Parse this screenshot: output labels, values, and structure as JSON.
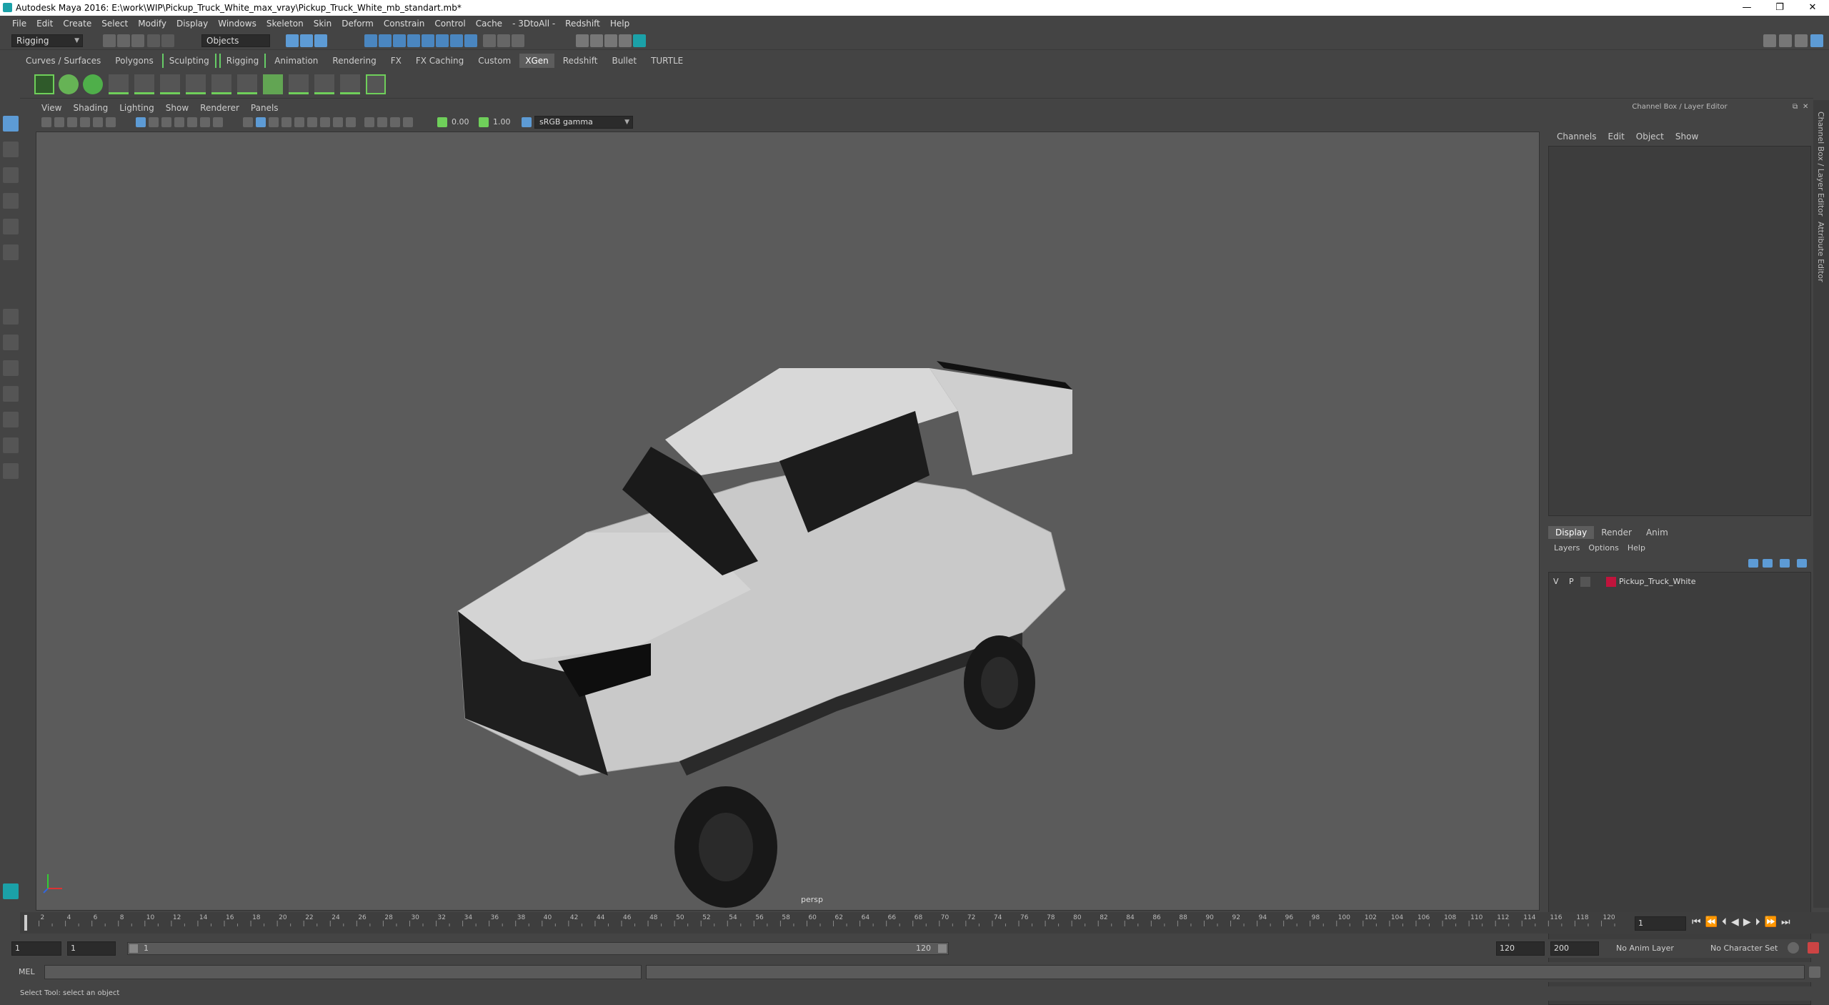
{
  "window": {
    "title": "Autodesk Maya 2016: E:\\work\\WIP\\Pickup_Truck_White_max_vray\\Pickup_Truck_White_mb_standart.mb*",
    "minimize": "—",
    "maximize": "❐",
    "close": "✕"
  },
  "menubar": [
    "File",
    "Edit",
    "Create",
    "Select",
    "Modify",
    "Display",
    "Windows",
    "Skeleton",
    "Skin",
    "Deform",
    "Constrain",
    "Control",
    "Cache",
    "- 3DtoAll -",
    "Redshift",
    "Help"
  ],
  "statusline": {
    "mode": "Rigging",
    "selection_mode": "Objects"
  },
  "shelf_tabs": [
    {
      "label": "Curves / Surfaces",
      "active": false,
      "bracket": false
    },
    {
      "label": "Polygons",
      "active": false,
      "bracket": false
    },
    {
      "label": "Sculpting",
      "active": false,
      "bracket": true
    },
    {
      "label": "Rigging",
      "active": false,
      "bracket": true
    },
    {
      "label": "Animation",
      "active": false,
      "bracket": false
    },
    {
      "label": "Rendering",
      "active": false,
      "bracket": false
    },
    {
      "label": "FX",
      "active": false,
      "bracket": false
    },
    {
      "label": "FX Caching",
      "active": false,
      "bracket": false
    },
    {
      "label": "Custom",
      "active": false,
      "bracket": false
    },
    {
      "label": "XGen",
      "active": true,
      "bracket": false
    },
    {
      "label": "Redshift",
      "active": false,
      "bracket": false
    },
    {
      "label": "Bullet",
      "active": false,
      "bracket": false
    },
    {
      "label": "TURTLE",
      "active": false,
      "bracket": false
    }
  ],
  "viewport": {
    "menu": [
      "View",
      "Shading",
      "Lighting",
      "Show",
      "Renderer",
      "Panels"
    ],
    "exposure": "0.00",
    "gamma": "1.00",
    "color_space": "sRGB gamma",
    "camera_label": "persp"
  },
  "channel_box": {
    "title": "Channel Box / Layer Editor",
    "menu": [
      "Channels",
      "Edit",
      "Object",
      "Show"
    ]
  },
  "layer_editor": {
    "tabs": [
      "Display",
      "Render",
      "Anim"
    ],
    "active_tab": "Display",
    "menu": [
      "Layers",
      "Options",
      "Help"
    ],
    "layers": [
      {
        "v": "V",
        "p": "P",
        "color": "#c0143c",
        "name": "Pickup_Truck_White"
      }
    ]
  },
  "right_strip": {
    "tab1": "Channel Box / Layer Editor",
    "tab2": "Attribute Editor"
  },
  "timeline": {
    "ticks": [
      "2",
      "4",
      "6",
      "8",
      "10",
      "12",
      "14",
      "16",
      "18",
      "20",
      "22",
      "24",
      "26",
      "28",
      "30",
      "32",
      "34",
      "36",
      "38",
      "40",
      "42",
      "44",
      "46",
      "48",
      "50",
      "52",
      "54",
      "56",
      "58",
      "60",
      "62",
      "64",
      "66",
      "68",
      "70",
      "72",
      "74",
      "76",
      "78",
      "80",
      "82",
      "84",
      "86",
      "88",
      "90",
      "92",
      "94",
      "96",
      "98",
      "100",
      "102",
      "104",
      "106",
      "108",
      "110",
      "112",
      "114",
      "116",
      "118",
      "120"
    ],
    "current_frame": "1"
  },
  "range": {
    "start": "1",
    "playback_start": "1",
    "slider_start": "1",
    "slider_end": "120",
    "playback_end": "120",
    "end": "200",
    "anim_layer": "No Anim Layer",
    "character_set": "No Character Set"
  },
  "cmdline": {
    "label": "MEL"
  },
  "helpline": {
    "text": "Select Tool: select an object"
  },
  "colors": {
    "accent": "#5d9bd5",
    "shelf_green": "#6fcf5a",
    "maya_teal": "#1ba1a8"
  }
}
